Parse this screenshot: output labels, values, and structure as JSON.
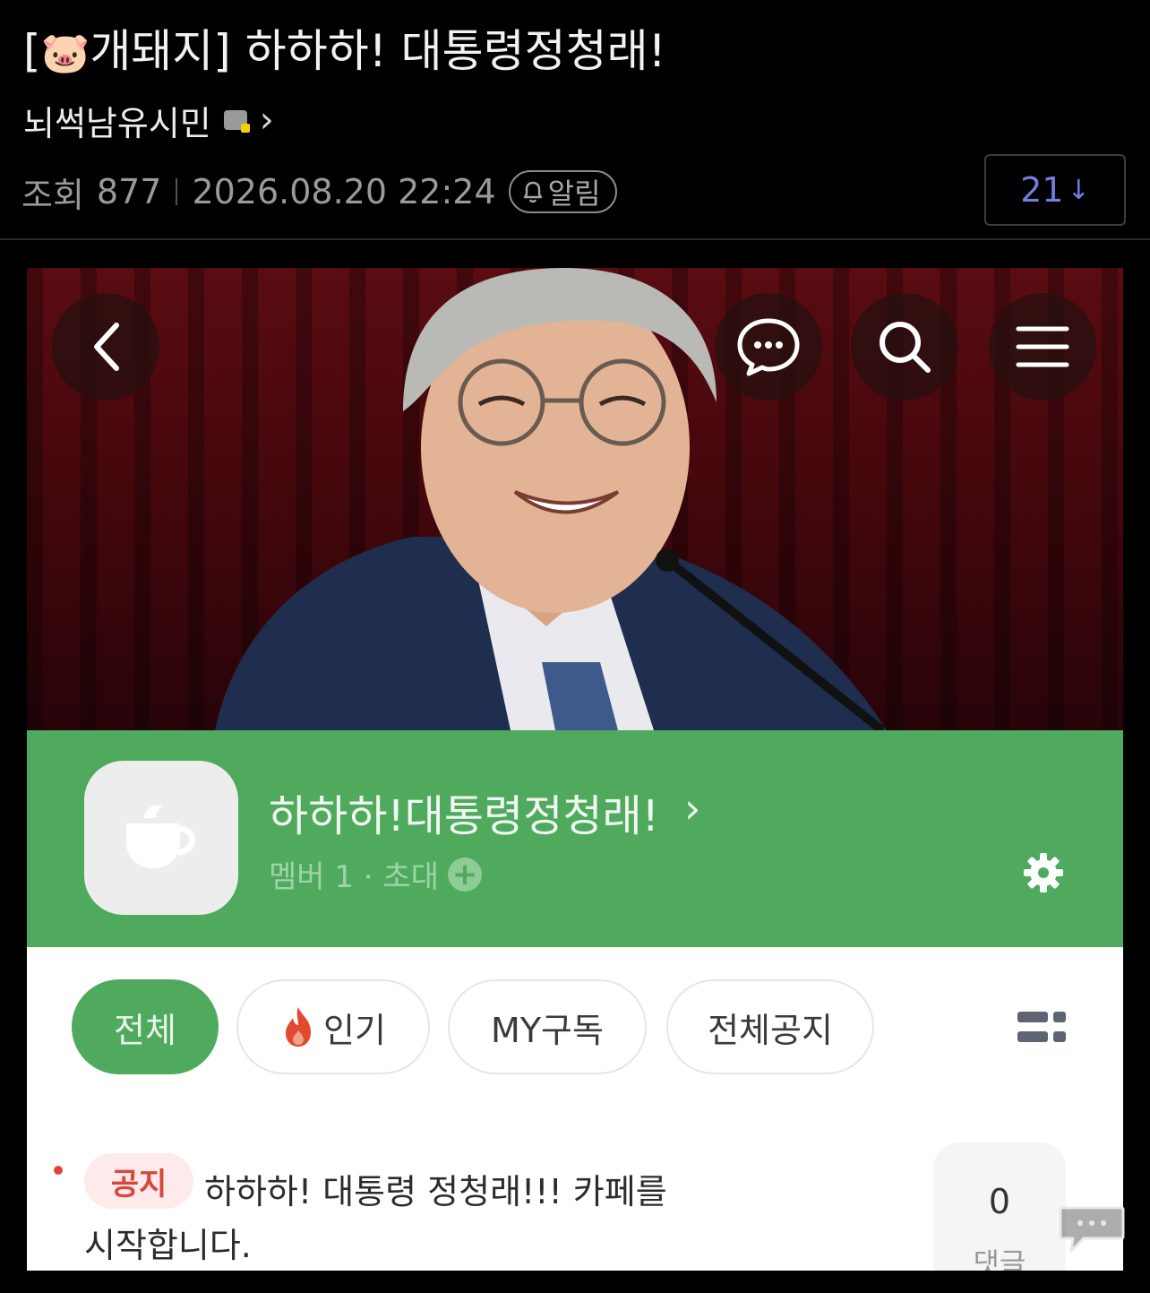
{
  "post": {
    "title_prefix": "[",
    "title_emoji": "🐷",
    "title_rest": "개돼지] 하하하! 대통령정청래!",
    "author": "뇌썩남유시민",
    "views_label": "조회",
    "views": "877",
    "datetime": "2026.08.20 22:24",
    "alarm_label": "알림",
    "comment_count": "21",
    "comment_arrow": "↓"
  },
  "cafe": {
    "name": "하하하!대통령정청래!",
    "members_label": "멤버 1 · 초대",
    "invite_symbol": "+",
    "tabs": [
      {
        "label": "전체",
        "active": true
      },
      {
        "label": "인기",
        "active": false,
        "icon": "fire-icon"
      },
      {
        "label": "MY구독",
        "active": false
      },
      {
        "label": "전체공지",
        "active": false
      }
    ],
    "notice": {
      "badge": "공지",
      "line1": "하하하! 대통령 정청래!!! 카페를",
      "line2": "시작합니다.",
      "comments": "0",
      "comments_label": "댓글"
    }
  },
  "colors": {
    "cafe_green": "#4faa5e",
    "comment_count_blue": "#6f7ee0",
    "notice_red": "#d8463c"
  },
  "icons": [
    "back-chevron-icon",
    "chat-bubble-icon",
    "search-icon",
    "menu-icon",
    "cafe-cup-icon",
    "gear-icon",
    "fire-icon",
    "grid-list-icon",
    "bell-icon",
    "comment-icon"
  ]
}
